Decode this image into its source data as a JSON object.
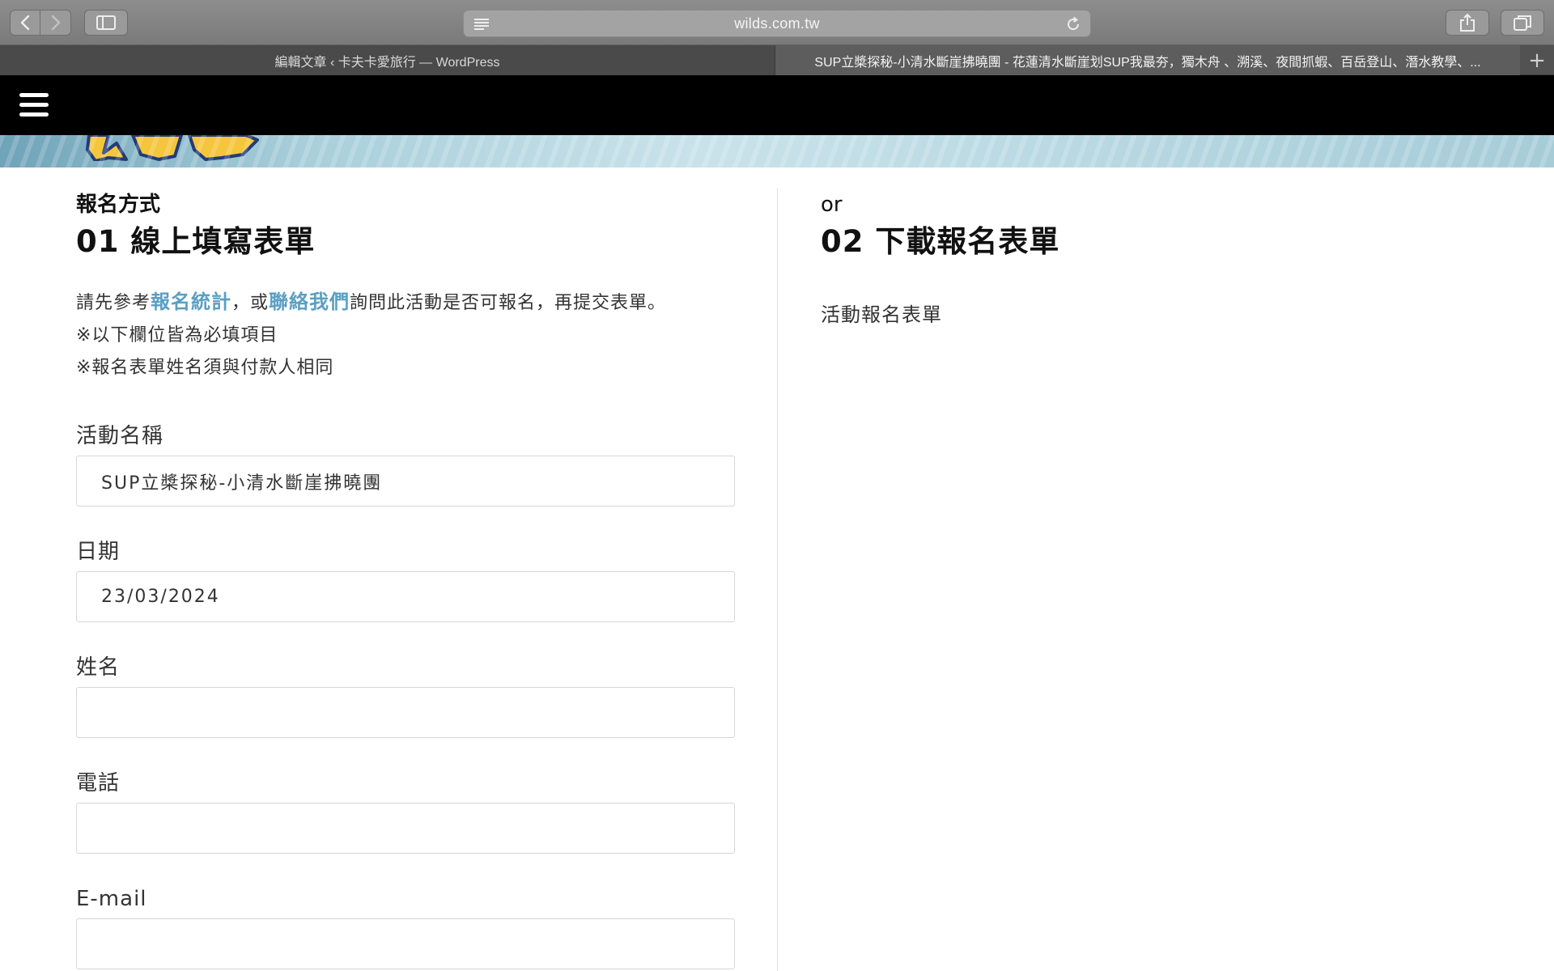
{
  "browser": {
    "url": "wilds.com.tw",
    "tabs": [
      {
        "label": "編輯文章 ‹ 卡夫卡愛旅行 — WordPress",
        "active": false
      },
      {
        "label": "SUP立槳探秘-小清水斷崖拂曉團 - 花蓮清水斷崖划SUP我最夯，獨木舟 、溯溪、夜間抓蝦、百岳登山、潛水教學、...",
        "active": true
      }
    ],
    "new_tab_label": "+"
  },
  "left": {
    "kicker": "報名方式",
    "heading": "01 線上填寫表單",
    "intro_before": "請先參考",
    "intro_link1": "報名統計",
    "intro_mid": "，或",
    "intro_link2": "聯絡我們",
    "intro_after": "詢問此活動是否可報名，再提交表單。",
    "note1": "※以下欄位皆為必填項目",
    "note2": "※報名表單姓名須與付款人相同",
    "fields": [
      {
        "label": "活動名稱",
        "value": "SUP立槳探秘-小清水斷崖拂曉團"
      },
      {
        "label": "日期",
        "value": "23/03/2024"
      },
      {
        "label": "姓名",
        "value": ""
      },
      {
        "label": "電話",
        "value": ""
      },
      {
        "label": "E-mail",
        "value": ""
      }
    ]
  },
  "right": {
    "kicker": "or",
    "heading": "02 下載報名表單",
    "download_link": "活動報名表單"
  },
  "colors": {
    "accent_link": "#5a9fc2",
    "header_bg": "#000000"
  }
}
